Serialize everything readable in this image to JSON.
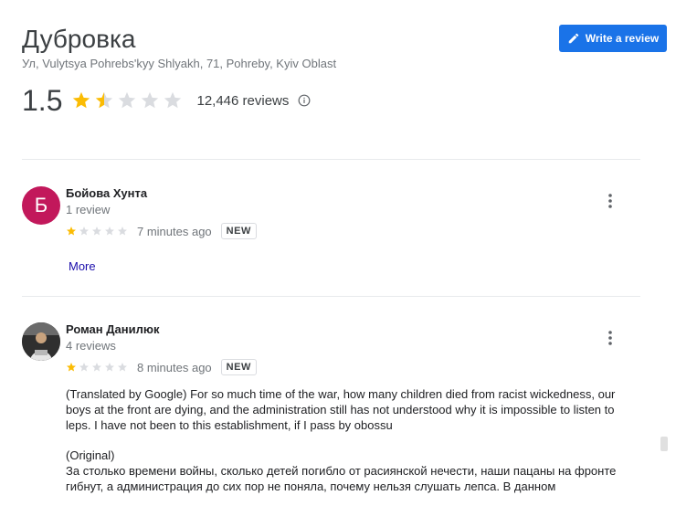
{
  "place": {
    "title": "Дубровка",
    "address": "Ул, Vulytsya Pohrebs'kyy Shlyakh, 71, Pohreby, Kyiv Oblast",
    "rating": "1.5",
    "rating_value": 1.5,
    "rating_max": 5,
    "review_count": "12,446 reviews"
  },
  "actions": {
    "write_review": "Write a review"
  },
  "colors": {
    "accent": "#1a73e8",
    "star_filled": "#fbbc04",
    "star_empty": "#dadce0",
    "avatar_bg": "#c2185b"
  },
  "reviews": [
    {
      "avatar_letter": "Б",
      "author": "Бойова Хунта",
      "author_reviews": "1 review",
      "stars": 1,
      "time": "7 minutes ago",
      "badge": "NEW",
      "more": "More"
    },
    {
      "author": "Роман Данилюк",
      "author_reviews": "4 reviews",
      "stars": 1,
      "time": "8 minutes ago",
      "badge": "NEW",
      "translated": "(Translated by Google) For so much time of the war, how many children died from racist wickedness, our boys at the front are dying, and the administration still has not understood why it is impossible to listen to leps. I have not been to this establishment, if I pass by obossu",
      "original_label": "(Original)",
      "original": "За столько времени войны, сколько детей погибло от расиянской нечести, наши пацаны на фронте гибнут, а администрация до сих пор не поняла, почему нельзя слушать лепса. В данном"
    }
  ],
  "icons": {
    "info": "info-icon",
    "pencil": "pencil-icon",
    "more": "more-vert-icon"
  }
}
